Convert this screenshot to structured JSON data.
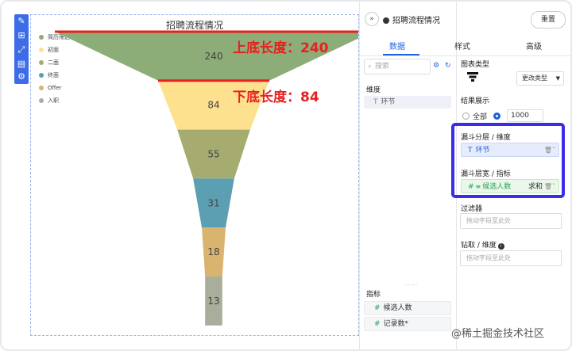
{
  "chart_data": {
    "type": "funnel",
    "title": "招聘流程情况",
    "categories": [
      "简历筛选",
      "初面",
      "二面",
      "终面",
      "Offer",
      "入职"
    ],
    "values": [
      240,
      84,
      55,
      31,
      18,
      13
    ],
    "colors": [
      "#8cad78",
      "#fde18e",
      "#a6ac70",
      "#5c9fb2",
      "#d9b46e",
      "#a9ae9c"
    ],
    "legend_position": "top-left"
  },
  "annotations": {
    "top": "上底长度：240",
    "bottom": "下底长度：84"
  },
  "header": {
    "title": "招聘流程情况",
    "reset": "重置",
    "collapse_icon": "»"
  },
  "tabs": [
    "数据",
    "样式",
    "高级"
  ],
  "data_panel": {
    "search_placeholder": "搜索",
    "dimension_label": "维度",
    "dimensions": [
      "环节"
    ],
    "metric_label": "指标",
    "metrics": [
      "候选人数",
      "记录数*"
    ]
  },
  "settings": {
    "chart_type_label": "图表类型",
    "change_type": "更改类型",
    "result_label": "结果展示",
    "all_option": "全部",
    "limit_value": "1000",
    "funnel_layer_label": "漏斗分层 / 维度",
    "funnel_layer_field": "环节",
    "funnel_width_label": "漏斗层宽 / 指标",
    "funnel_width_field": "候选人数",
    "agg_label": "求和",
    "filter_label": "过滤器",
    "filter_placeholder": "拖动字段至此处",
    "drill_label": "钻取 / 维度",
    "drill_placeholder": "拖动字段至此处"
  },
  "watermark": "@稀土掘金技术社区"
}
